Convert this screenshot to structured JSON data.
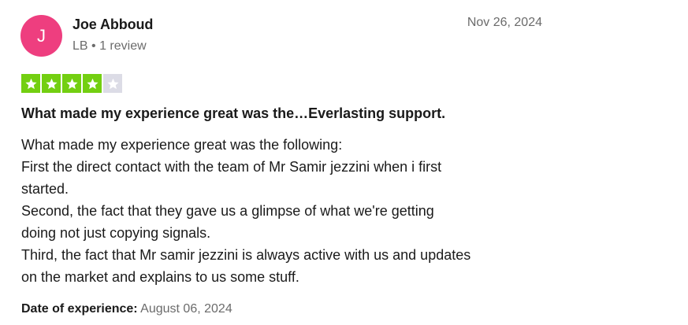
{
  "reviewer": {
    "initial": "J",
    "name": "Joe Abboud",
    "meta": "LB • 1 review",
    "avatar_color": "#ee3e7f"
  },
  "review": {
    "date": "Nov 26, 2024",
    "rating": 4,
    "rating_max": 5,
    "star_color": "#73cf11",
    "title": "What made my experience great was the…Everlasting support.",
    "body_lines": [
      "What made my experience great was the following:",
      "First the direct contact with the team of Mr Samir jezzini when i first",
      "started.",
      "Second, the fact that they gave us a glimpse of what we're getting",
      "doing not just copying signals.",
      "Third, the fact that Mr samir jezzini is always active with us and updates",
      "on the market and explains to us some stuff."
    ],
    "experience_label": "Date of experience:",
    "experience_date": "August 06, 2024"
  }
}
